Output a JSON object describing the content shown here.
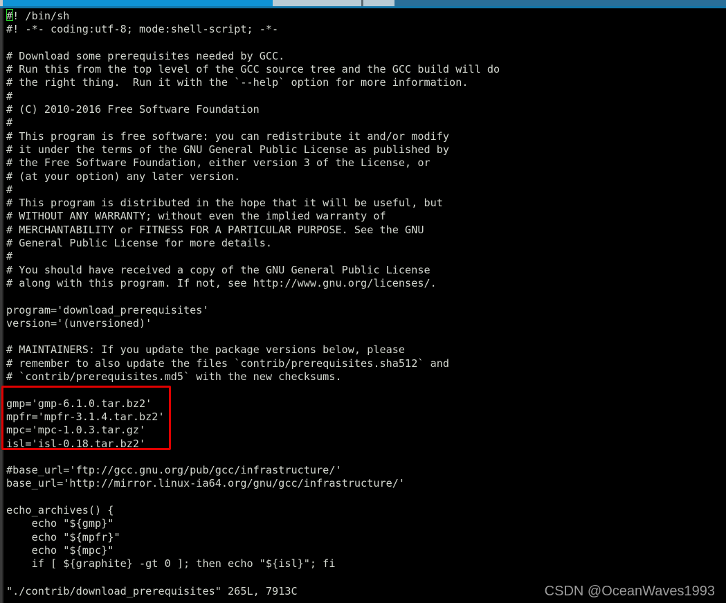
{
  "window": {
    "topbar": {
      "active_tab_color": "#0f93d6",
      "inactive_tab_color": "#b9ccd6",
      "base_color": "#2a6f99"
    }
  },
  "terminal": {
    "background": "#000000",
    "foreground": "#d3d7cf",
    "cursor_color": "#2dd82d",
    "lines": [
      "#! /bin/sh",
      "#! -*- coding:utf-8; mode:shell-script; -*-",
      "",
      "# Download some prerequisites needed by GCC.",
      "# Run this from the top level of the GCC source tree and the GCC build will do",
      "# the right thing.  Run it with the `--help` option for more information.",
      "#",
      "# (C) 2010-2016 Free Software Foundation",
      "#",
      "# This program is free software: you can redistribute it and/or modify",
      "# it under the terms of the GNU General Public License as published by",
      "# the Free Software Foundation, either version 3 of the License, or",
      "# (at your option) any later version.",
      "#",
      "# This program is distributed in the hope that it will be useful, but",
      "# WITHOUT ANY WARRANTY; without even the implied warranty of",
      "# MERCHANTABILITY or FITNESS FOR A PARTICULAR PURPOSE. See the GNU",
      "# General Public License for more details.",
      "#",
      "# You should have received a copy of the GNU General Public License",
      "# along with this program. If not, see http://www.gnu.org/licenses/.",
      "",
      "program='download_prerequisites'",
      "version='(unversioned)'",
      "",
      "# MAINTAINERS: If you update the package versions below, please",
      "# remember to also update the files `contrib/prerequisites.sha512` and",
      "# `contrib/prerequisites.md5` with the new checksums.",
      "",
      "gmp='gmp-6.1.0.tar.bz2'",
      "mpfr='mpfr-3.1.4.tar.bz2'",
      "mpc='mpc-1.0.3.tar.gz'",
      "isl='isl-0.18.tar.bz2'",
      "",
      "#base_url='ftp://gcc.gnu.org/pub/gcc/infrastructure/'",
      "base_url='http://mirror.linux-ia64.org/gnu/gcc/infrastructure/'",
      "",
      "echo_archives() {",
      "    echo \"${gmp}\"",
      "    echo \"${mpfr}\"",
      "    echo \"${mpc}\"",
      "    if [ ${graphite} -gt 0 ]; then echo \"${isl}\"; fi",
      "}"
    ],
    "status_line": "\"./contrib/download_prerequisites\" 265L, 7913C"
  },
  "annotation": {
    "highlight_box_color": "#e00000",
    "highlighted_lines": [
      "gmp='gmp-6.1.0.tar.bz2'",
      "mpfr='mpfr-3.1.4.tar.bz2'",
      "mpc='mpc-1.0.3.tar.gz'",
      "isl='isl-0.18.tar.bz2'"
    ]
  },
  "watermark": {
    "text": "CSDN @OceanWaves1993",
    "color": "#9b9b9b"
  }
}
